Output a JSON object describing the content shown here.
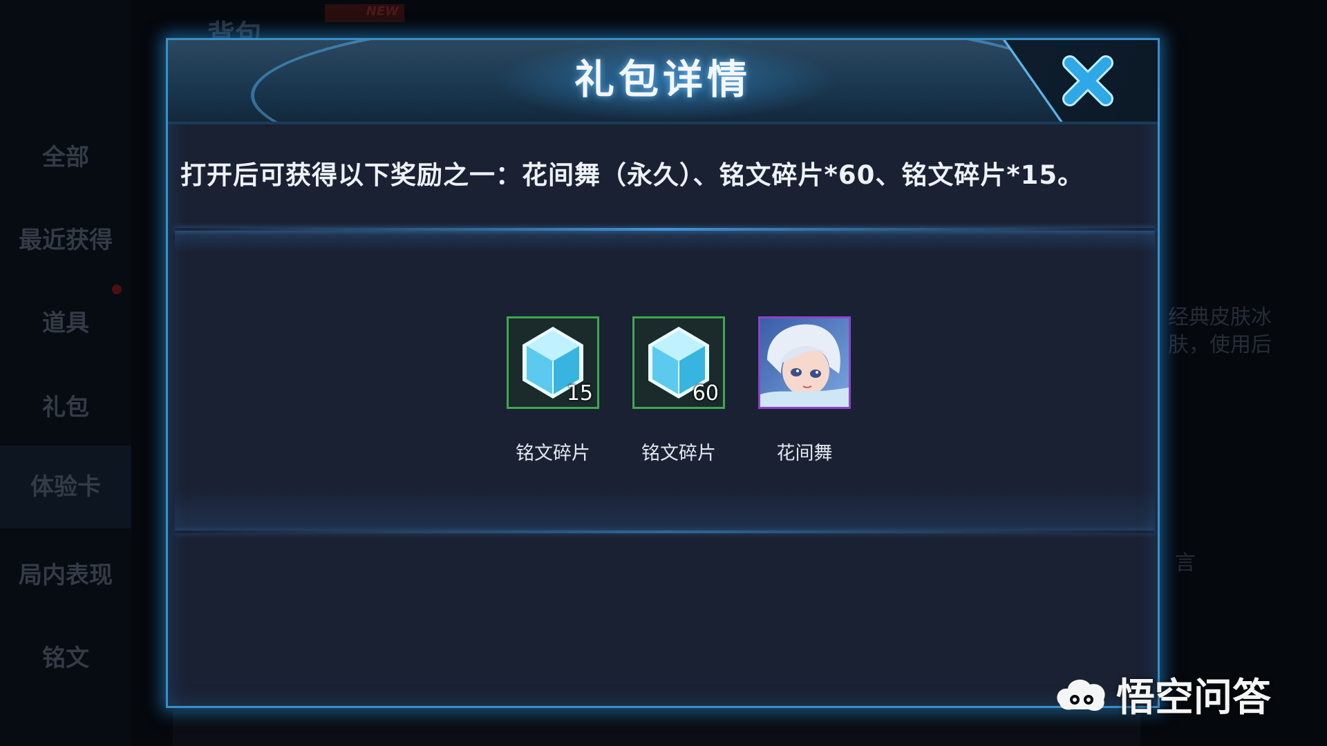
{
  "background": {
    "top_title": "背包",
    "top_badge": "NEW",
    "sidebar": [
      "全部",
      "最近获得",
      "道具",
      "礼包",
      "体验卡",
      "局内表现",
      "铭文"
    ],
    "right_text": [
      "经典皮肤冰",
      "肤，使用后"
    ],
    "right_text2": "言"
  },
  "dialog": {
    "title": "礼包详情",
    "close_icon": "close-x-icon",
    "description": "打开后可获得以下奖励之一：花间舞（永久）、铭文碎片*60、铭文碎片*15。",
    "rewards": [
      {
        "label": "铭文碎片",
        "count": "15",
        "icon": "inscription-shard-icon",
        "rarity_color": "#3fa84a"
      },
      {
        "label": "铭文碎片",
        "count": "60",
        "icon": "inscription-shard-icon",
        "rarity_color": "#3fa84a"
      },
      {
        "label": "花间舞",
        "count": "",
        "icon": "skin-portrait-icon",
        "rarity_color": "#8c46c8"
      }
    ]
  },
  "watermark": "悟空问答",
  "colors": {
    "accent": "#3a8fc7",
    "panel": "#1a2133",
    "close": "#2ea8e6"
  }
}
